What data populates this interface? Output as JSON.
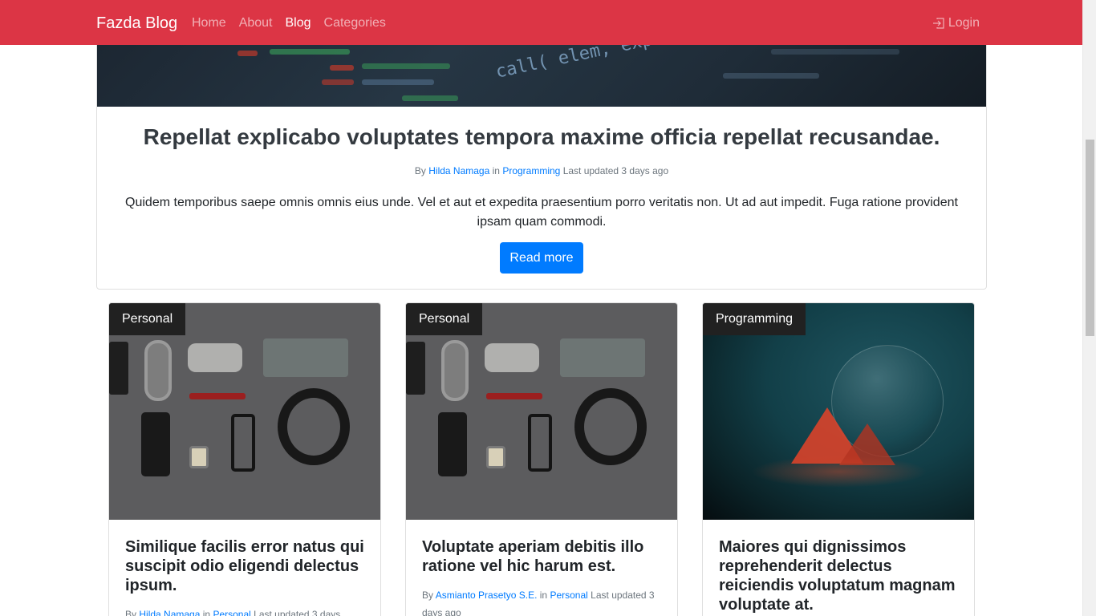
{
  "navbar": {
    "brand": "Fazda Blog",
    "links": [
      "Home",
      "About",
      "Blog",
      "Categories"
    ],
    "active": "Blog",
    "login": "Login"
  },
  "featured": {
    "title": "Repellat explicabo voluptates tempora maxime officia repellat recusandae.",
    "by": "By",
    "author": "Hilda Namaga",
    "in": "in",
    "category": "Programming",
    "updated": "Last updated 3 days ago",
    "excerpt": "Quidem temporibus saepe omnis omnis eius unde. Vel et aut et expedita praesentium porro veritatis non. Ut ad aut impedit. Fuga ratione provident ipsam quam commodi.",
    "read_more": "Read more",
    "hero_code": "call( elem, expr"
  },
  "posts": [
    {
      "category": "Personal",
      "title": "Similique facilis error natus qui suscipit odio eligendi delectus ipsum.",
      "by": "By",
      "author": "Hilda Namaga",
      "in": "in",
      "post_category": "Personal",
      "updated": "Last updated 3 days"
    },
    {
      "category": "Personal",
      "title": "Voluptate aperiam debitis illo ratione vel hic harum est.",
      "by": "By",
      "author": "Asmianto Prasetyo S.E.",
      "in": "in",
      "post_category": "Personal",
      "updated": "Last updated 3 days ago"
    },
    {
      "category": "Programming",
      "title": "Maiores qui dignissimos reprehenderit delectus reiciendis voluptatum magnam voluptate at."
    }
  ],
  "colors": {
    "navbar": "#dc3545",
    "primary": "#007bff",
    "badge": "#212121"
  }
}
